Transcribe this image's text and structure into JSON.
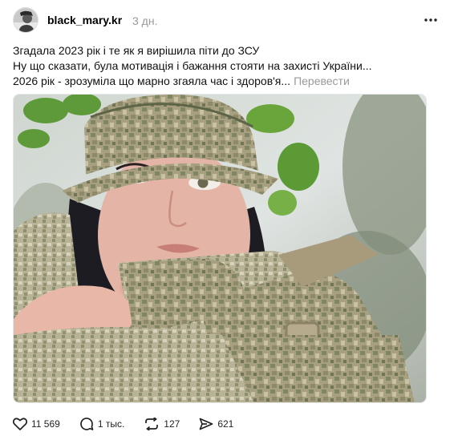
{
  "post": {
    "username": "black_mary.kr",
    "time": "3 дн.",
    "lines": [
      "Згадала 2023 рік і те як я вирішила піти до ЗСУ",
      "Ну що сказати, була мотивація і бажання стояти на захисті України...",
      "2026 рік - зрозуміла що марно згаяла час і здоров'я..."
    ],
    "translate_label": "Перевести"
  },
  "actions": {
    "likes": "11 569",
    "comments": "1 тыс.",
    "reposts": "127",
    "shares": "621"
  },
  "colors": {
    "text": "#111111",
    "muted": "#999999",
    "border": "#e6e6e6"
  },
  "icons": {
    "more": "more-horizontal-icon",
    "like": "heart-icon",
    "comment": "speech-bubble-icon",
    "repost": "repost-arrows-icon",
    "share": "send-icon"
  }
}
